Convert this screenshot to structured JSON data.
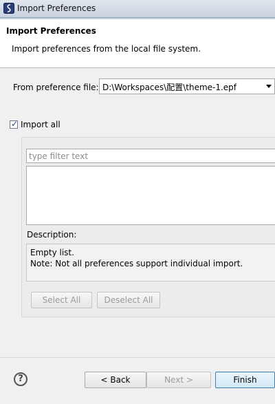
{
  "window": {
    "title": "Import Preferences",
    "app_icon": "eclipse-icon"
  },
  "header": {
    "title": "Import Preferences",
    "description": "Import preferences from the local file system."
  },
  "preference_file": {
    "label": "From preference file:",
    "value": "D:\\Workspaces\\配置\\theme-1.epf"
  },
  "import_all": {
    "label": "Import all",
    "checked": true
  },
  "filter": {
    "placeholder": "type filter text"
  },
  "description": {
    "label": "Description:",
    "lines": [
      "Empty list.",
      "Note: Not all preferences support individual import."
    ]
  },
  "group_buttons": {
    "select_all": "Select All",
    "deselect_all": "Deselect All"
  },
  "footer": {
    "help_icon": "help-icon",
    "back": "< Back",
    "next": "Next >",
    "finish": "Finish"
  }
}
